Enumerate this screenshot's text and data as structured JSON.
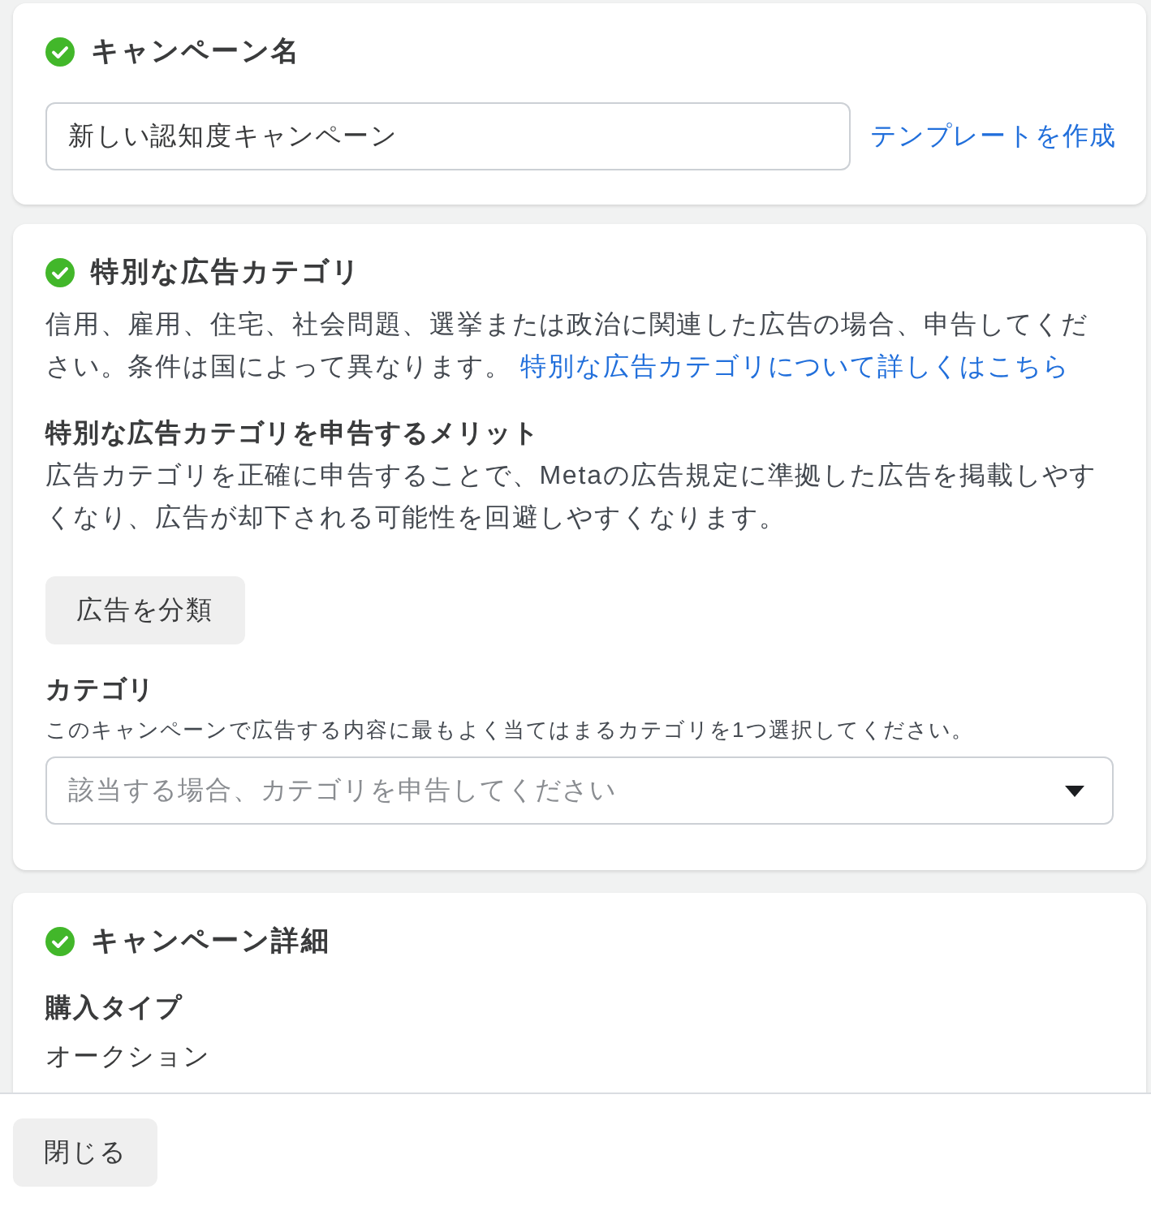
{
  "campaign_name": {
    "title": "キャンペーン名",
    "complete": true,
    "name_field": {
      "value": "新しい認知度キャンペーン"
    },
    "template_link": "テンプレートを作成"
  },
  "special_ad_categories": {
    "title": "特別な広告カテゴリ",
    "complete": true,
    "description": "信用、雇用、住宅、社会問題、選挙または政治に関連した広告の場合、申告してください。条件は国によって異なります。",
    "learn_more_link": "特別な広告カテゴリについて詳しくはこちら",
    "benefit_heading": "特別な広告カテゴリを申告するメリット",
    "benefit_text": "広告カテゴリを正確に申告することで、Metaの広告規定に準拠した広告を掲載しやすくなり、広告が却下される可能性を回避しやすくなります。",
    "classify_button": "広告を分類",
    "category": {
      "label": "カテゴリ",
      "hint": "このキャンペーンで広告する内容に最もよく当てはまるカテゴリを1つ選択してください。",
      "placeholder": "該当する場合、カテゴリを申告してください"
    }
  },
  "campaign_details": {
    "title": "キャンペーン詳細",
    "complete": true,
    "fields": [
      {
        "label": "購入タイプ",
        "value": "オークション"
      }
    ]
  },
  "footer": {
    "close_button": "閉じる"
  }
}
